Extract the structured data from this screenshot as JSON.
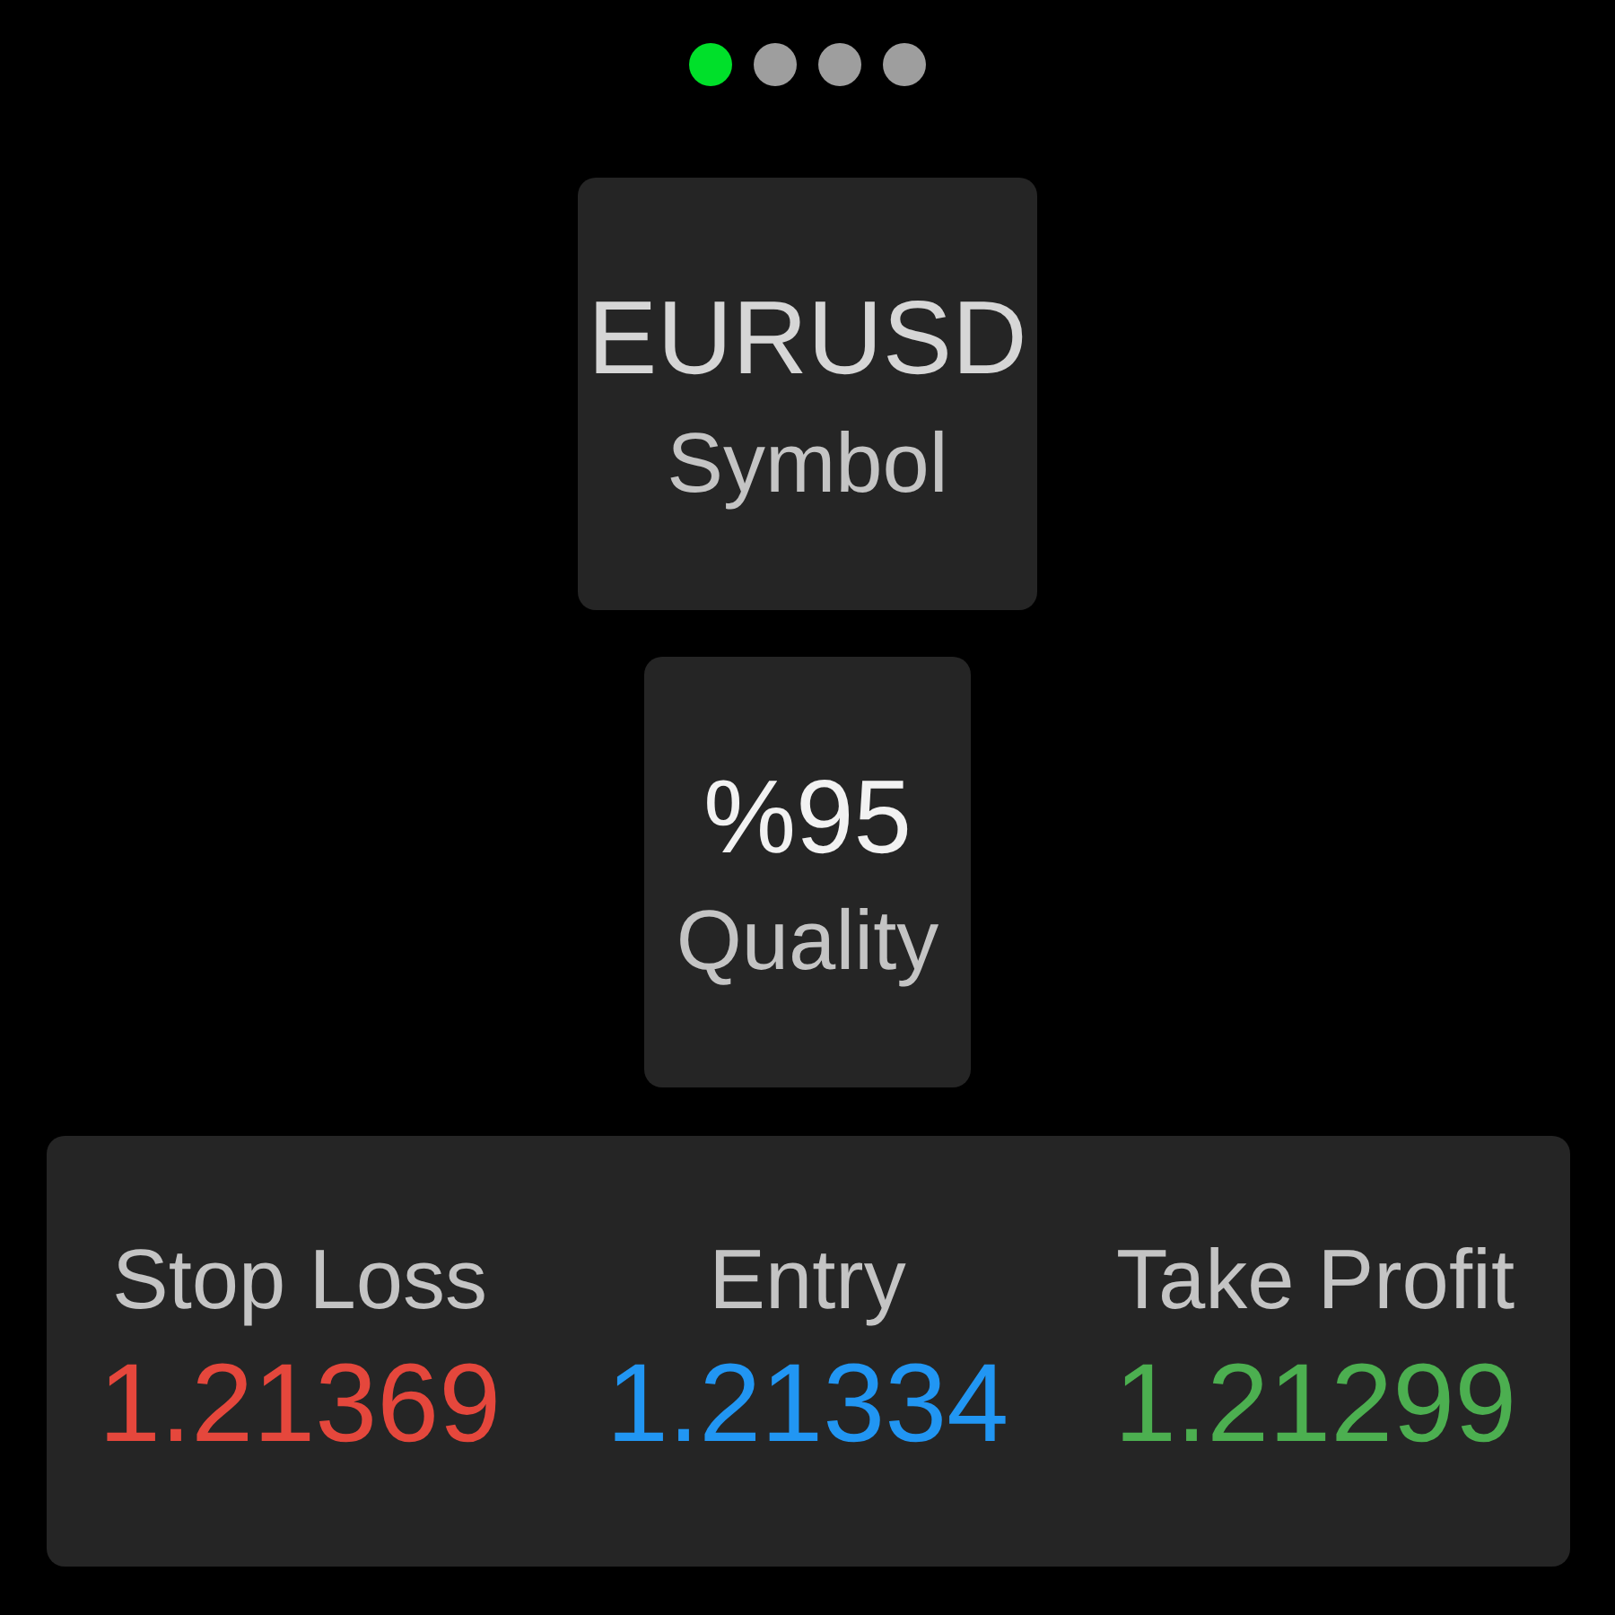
{
  "pager": {
    "dots": [
      {
        "selected": true
      },
      {
        "selected": false
      },
      {
        "selected": false
      },
      {
        "selected": false
      }
    ]
  },
  "symbol": {
    "value": "EURUSD",
    "label": "Symbol"
  },
  "quality": {
    "value": "%95",
    "label": "Quality"
  },
  "levels": [
    {
      "label": "Stop Loss",
      "value": "1.21369",
      "color": "#e5473c"
    },
    {
      "label": "Entry",
      "value": "1.21334",
      "color": "#2196f3"
    },
    {
      "label": "Take Profit",
      "value": "1.21299",
      "color": "#4caf50"
    }
  ]
}
